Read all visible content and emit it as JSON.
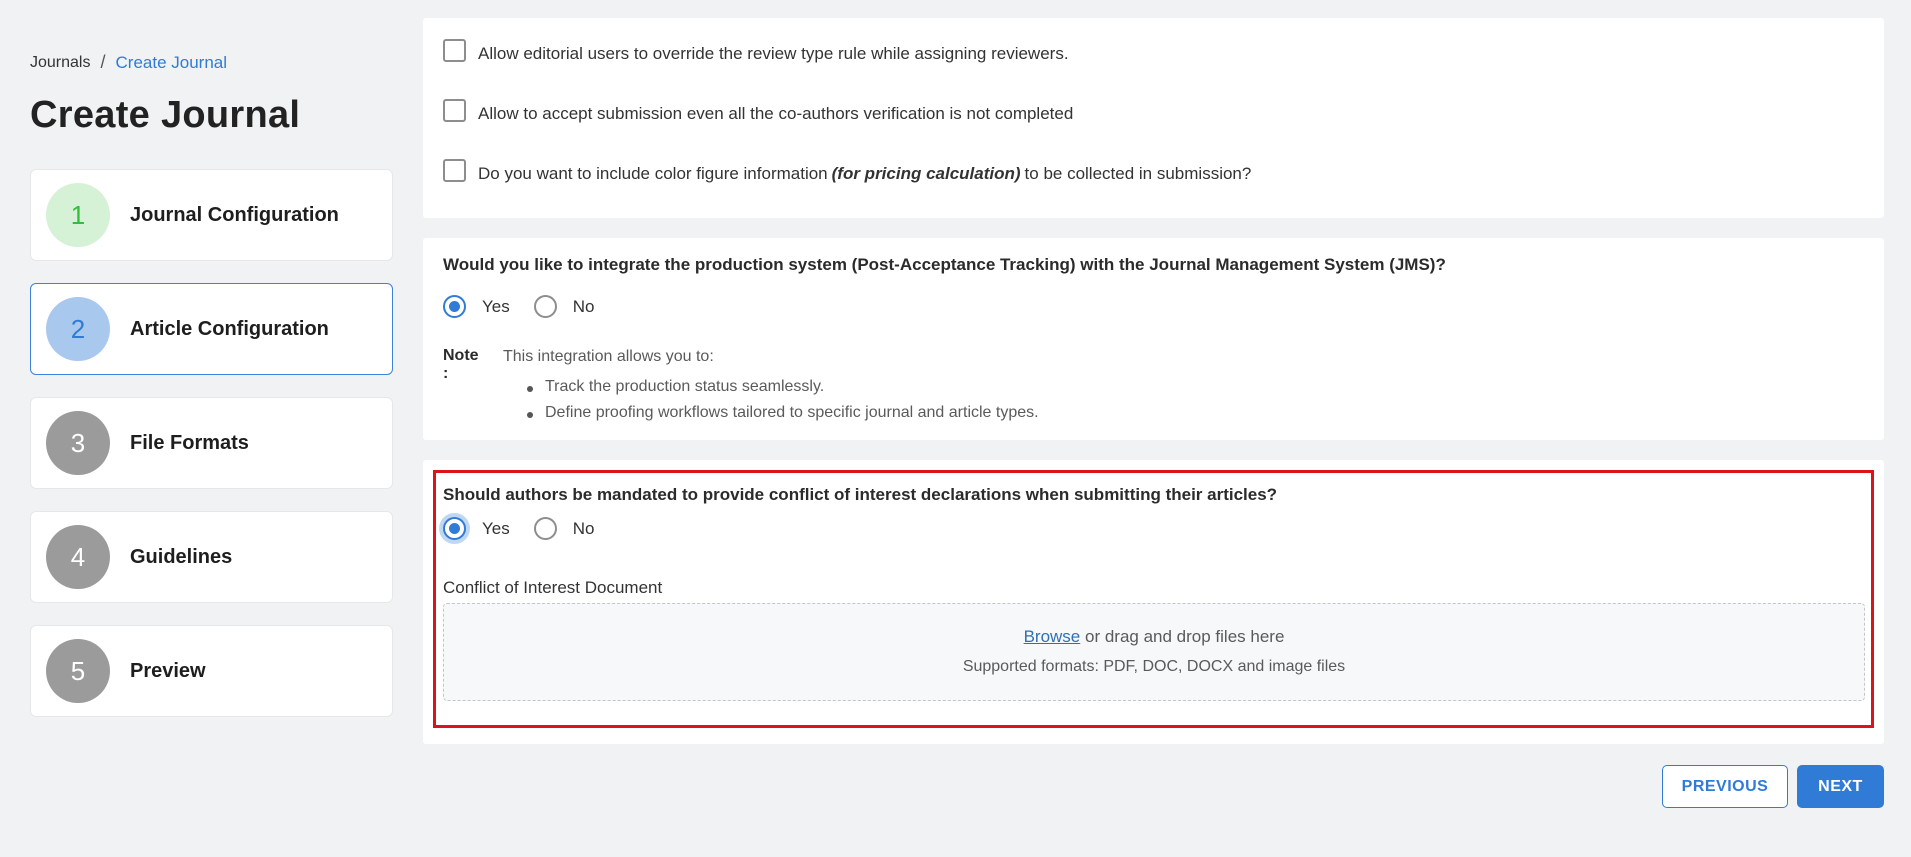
{
  "breadcrumb": {
    "parent": "Journals",
    "separator": "/",
    "current": "Create Journal"
  },
  "page": {
    "title": "Create Journal"
  },
  "steps": [
    {
      "number": "1",
      "label": "Journal Configuration",
      "circle_color": "#d5f2d6",
      "number_color": "#2fbf3a",
      "state": "completed"
    },
    {
      "number": "2",
      "label": "Article Configuration",
      "circle_color": "#a9c8ee",
      "number_color": "#2f7bd6",
      "state": "active"
    },
    {
      "number": "3",
      "label": "File Formats",
      "circle_color": "#9b9b9b",
      "number_color": "#ffffff",
      "state": "pending"
    },
    {
      "number": "4",
      "label": "Guidelines",
      "circle_color": "#9b9b9b",
      "number_color": "#ffffff",
      "state": "pending"
    },
    {
      "number": "5",
      "label": "Preview",
      "circle_color": "#9b9b9b",
      "number_color": "#ffffff",
      "state": "pending"
    }
  ],
  "options": {
    "override_review": {
      "label": "Allow editorial users to override the review type rule while assigning reviewers.",
      "checked": false
    },
    "accept_submission": {
      "label": "Allow to accept submission even all the co-authors verification is not completed",
      "checked": false
    },
    "color_figure": {
      "label_before": "Do you want to include color figure information",
      "label_emphasis": "(for pricing calculation)",
      "label_after": "to be collected in submission?",
      "checked": false
    }
  },
  "production": {
    "question": "Would you like to integrate the production system (Post-Acceptance Tracking) with the Journal Management System (JMS)?",
    "yes_label": "Yes",
    "no_label": "No",
    "selected": "Yes",
    "note_label": "Note :",
    "note_text": "This integration allows you to:",
    "note_items": [
      "Track the production status seamlessly.",
      "Define proofing workflows tailored to specific journal and article types."
    ]
  },
  "conflict": {
    "question": "Should authors be mandated to provide conflict of interest declarations when submitting their articles?",
    "yes_label": "Yes",
    "no_label": "No",
    "selected": "Yes",
    "upload_label": "Conflict of Interest Document",
    "browse_label": "Browse",
    "drop_text": "or drag and drop files here",
    "formats_text": "Supported formats: PDF, DOC, DOCX and image files"
  },
  "buttons": {
    "previous": "PREVIOUS",
    "next": "NEXT"
  },
  "colors": {
    "accent": "#2f7bd6",
    "highlight_border": "#d9151b",
    "background": "#f1f2f4"
  }
}
